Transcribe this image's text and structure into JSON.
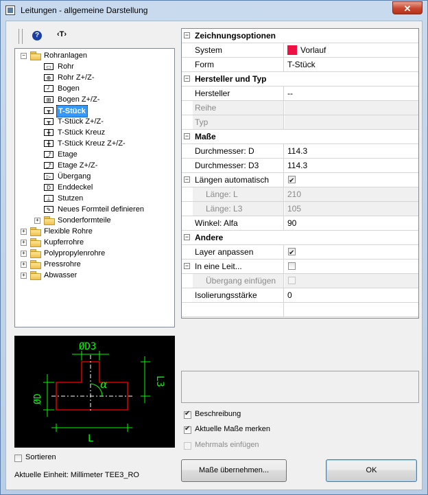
{
  "window": {
    "title": "Leitungen - allgemeine Darstellung",
    "close_label": "✕"
  },
  "toolbar": {
    "help_label": "?",
    "t_label": "‹T›"
  },
  "tree": [
    {
      "label": "Rohranlagen",
      "level": 1,
      "type": "folder",
      "expanded": true
    },
    {
      "label": "Rohr",
      "level": 2,
      "type": "item",
      "icon": "pipe-icon"
    },
    {
      "label": "Rohr Z+/Z-",
      "level": 2,
      "type": "item",
      "icon": "pipe-z-icon"
    },
    {
      "label": "Bogen",
      "level": 2,
      "type": "item",
      "icon": "elbow-icon"
    },
    {
      "label": "Bogen Z+/Z-",
      "level": 2,
      "type": "item",
      "icon": "elbow-z-icon"
    },
    {
      "label": "T-Stück",
      "level": 2,
      "type": "item",
      "icon": "tee-icon",
      "selected": true
    },
    {
      "label": "T-Stück Z+/Z-",
      "level": 2,
      "type": "item",
      "icon": "tee-z-icon"
    },
    {
      "label": "T-Stück Kreuz",
      "level": 2,
      "type": "item",
      "icon": "cross-icon"
    },
    {
      "label": "T-Stück Kreuz Z+/Z-",
      "level": 2,
      "type": "item",
      "icon": "cross-z-icon"
    },
    {
      "label": "Etage",
      "level": 2,
      "type": "item",
      "icon": "offset-icon"
    },
    {
      "label": "Etage Z+/Z-",
      "level": 2,
      "type": "item",
      "icon": "offset-z-icon"
    },
    {
      "label": "Übergang",
      "level": 2,
      "type": "item",
      "icon": "reducer-icon"
    },
    {
      "label": "Enddeckel",
      "level": 2,
      "type": "item",
      "icon": "endcap-icon"
    },
    {
      "label": "Stutzen",
      "level": 2,
      "type": "item",
      "icon": "nozzle-icon"
    },
    {
      "label": "Neues Formteil definieren",
      "level": 2,
      "type": "item",
      "icon": "new-fitting-icon"
    },
    {
      "label": "Sonderformteile",
      "level": 2,
      "type": "folder",
      "expanded": false
    },
    {
      "label": "Flexible Rohre",
      "level": 1,
      "type": "folder",
      "expanded": false
    },
    {
      "label": "Kupferrohre",
      "level": 1,
      "type": "folder",
      "expanded": false
    },
    {
      "label": "Polypropylenrohre",
      "level": 1,
      "type": "folder",
      "expanded": false
    },
    {
      "label": "Pressrohre",
      "level": 1,
      "type": "folder",
      "expanded": false
    },
    {
      "label": "Abwasser",
      "level": 1,
      "type": "folder",
      "expanded": false
    }
  ],
  "preview": {
    "label_d3": "ØD3",
    "label_d": "ØD",
    "label_l3": "L3",
    "label_l": "L",
    "label_alpha": "α",
    "line_color": "#00ff00",
    "body_color": "#ff0000"
  },
  "properties": [
    {
      "kind": "category",
      "label": "Zeichnungsoptionen",
      "toggle": "−"
    },
    {
      "kind": "prop",
      "name": "System",
      "value": "Vorlauf",
      "swatch": "#ee1144"
    },
    {
      "kind": "prop",
      "name": "Form",
      "value": "T-Stück"
    },
    {
      "kind": "category",
      "label": "Hersteller und Typ",
      "toggle": "−"
    },
    {
      "kind": "prop",
      "name": "Hersteller",
      "value": "--"
    },
    {
      "kind": "prop",
      "name": "Reihe",
      "value": "",
      "disabled": true
    },
    {
      "kind": "prop",
      "name": "Typ",
      "value": "",
      "disabled": true
    },
    {
      "kind": "category",
      "label": "Maße",
      "toggle": "−"
    },
    {
      "kind": "prop",
      "name": "Durchmesser: D",
      "value": "114.3"
    },
    {
      "kind": "prop",
      "name": "Durchmesser: D3",
      "value": "114.3"
    },
    {
      "kind": "prop",
      "name": "Längen automatisch",
      "checkbox": true,
      "checked": true,
      "toggle": "−"
    },
    {
      "kind": "prop",
      "name": "Länge: L",
      "value": "210",
      "disabled": true,
      "indent": true
    },
    {
      "kind": "prop",
      "name": "Länge: L3",
      "value": "105",
      "disabled": true,
      "indent": true
    },
    {
      "kind": "prop",
      "name": "Winkel: Alfa",
      "value": "90"
    },
    {
      "kind": "category",
      "label": "Andere",
      "toggle": "−"
    },
    {
      "kind": "prop",
      "name": "Layer anpassen",
      "checkbox": true,
      "checked": true
    },
    {
      "kind": "prop",
      "name": "In eine Leit...",
      "checkbox": true,
      "checked": false,
      "toggle": "−"
    },
    {
      "kind": "prop",
      "name": "Übergang einfügen",
      "checkbox": true,
      "checked": false,
      "disabled": true,
      "indent": true
    },
    {
      "kind": "prop",
      "name": "Isolierungsstärke",
      "value": "0"
    },
    {
      "kind": "prop",
      "name": "",
      "value": ""
    }
  ],
  "options": {
    "beschreibung": {
      "label": "Beschreibung",
      "checked": true
    },
    "aktuelle_masse": {
      "label": "Aktuelle Maße merken",
      "checked": true
    },
    "mehrmals": {
      "label": "Mehrmals einfügen",
      "checked": false,
      "disabled": true
    },
    "sortieren": {
      "label": "Sortieren",
      "checked": false
    }
  },
  "status": {
    "unit_text": "Aktuelle Einheit: Millimeter  TEE3_RO"
  },
  "buttons": {
    "masse_uebernehmen": "Maße übernehmen...",
    "ok": "OK"
  }
}
